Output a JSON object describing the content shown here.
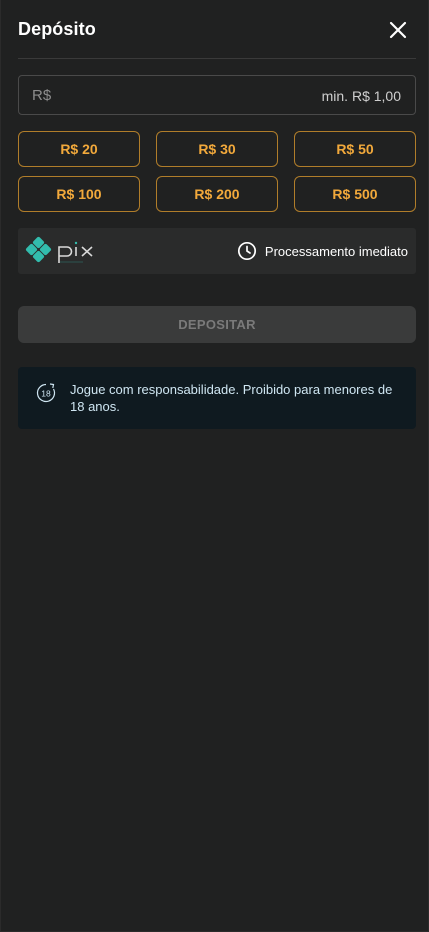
{
  "header": {
    "title": "Depósito"
  },
  "amount": {
    "currency_placeholder": "R$",
    "min_label": "min. R$ 1,00"
  },
  "presets": [
    "R$ 20",
    "R$ 30",
    "R$ 50",
    "R$ 100",
    "R$ 200",
    "R$ 500"
  ],
  "payment": {
    "processing_label": "Processamento imediato",
    "logo_icon": "pix-logo"
  },
  "actions": {
    "deposit_label": "DEPOSITAR"
  },
  "notice": {
    "age_badge": "18",
    "text": "Jogue com responsabilidade. Proibido para menores de 18 anos."
  },
  "colors": {
    "background": "#202121",
    "accent": "#f2a93b",
    "accent_border": "#b07d2a",
    "pix_teal": "#32bcad",
    "notice_bg": "#0f1a20"
  }
}
